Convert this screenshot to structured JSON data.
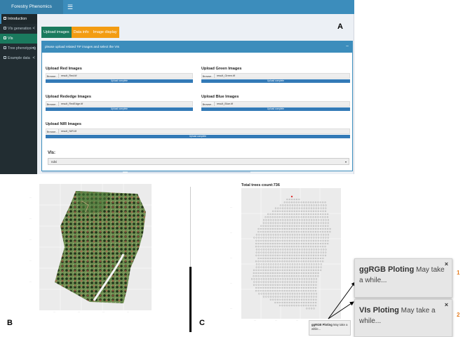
{
  "app": {
    "logo_text": "Forestry Phenomics",
    "menu_icon": "hamburger-icon"
  },
  "sidebar": {
    "items": [
      {
        "label": "Introduction",
        "chevron": ""
      },
      {
        "label": "VIs generation",
        "chevron": "<"
      },
      {
        "label": "VIs",
        "chevron": ""
      },
      {
        "label": "Tree phenotyping",
        "chevron": "<"
      },
      {
        "label": "Example data",
        "chevron": "<"
      }
    ]
  },
  "tabs": [
    "Upload images",
    "Data info",
    "Image display"
  ],
  "box": {
    "header": "please upload related TIF images and select the VIs",
    "collapse_symbol": "−"
  },
  "uploads": [
    {
      "label": "Upload Red Images",
      "browse": "Browse...",
      "filename": "result_Red.tif",
      "status": "Upload complete"
    },
    {
      "label": "Upload Green Images",
      "browse": "Browse...",
      "filename": "result_Green.tif",
      "status": "Upload complete"
    },
    {
      "label": "Upload Rededge Images",
      "browse": "Browse...",
      "filename": "result_RedEdge.tif",
      "status": "Upload complete"
    },
    {
      "label": "Upload Blue Images",
      "browse": "Browse...",
      "filename": "result_Blue.tif",
      "status": "Upload complete"
    },
    {
      "label": "Upload NIR Images",
      "browse": "Browse...",
      "filename": "result_NIR.tif",
      "status": "Upload complete"
    }
  ],
  "vis": {
    "label": "VIs:",
    "selected": "ndvi"
  },
  "panel_labels": {
    "a": "A",
    "b": "B",
    "c": "C"
  },
  "panel_c": {
    "title": "Total trees count:736"
  },
  "notifications": {
    "small": {
      "bold": "ggRGB Ploting",
      "text": "May take a while..."
    },
    "n1": {
      "bold": "ggRGB Ploting",
      "text": "May take a while...",
      "number": "1"
    },
    "n2": {
      "bold": "VIs Ploting",
      "text": "May take a while...",
      "number": "2"
    },
    "close_symbol": "×"
  },
  "colors": {
    "topbar": "#3c8dbc",
    "sidebar": "#222d32",
    "tab_green": "#1a7a5e",
    "tab_orange": "#f39c12",
    "progress": "#337ab7",
    "number_orange": "#e67e22"
  }
}
